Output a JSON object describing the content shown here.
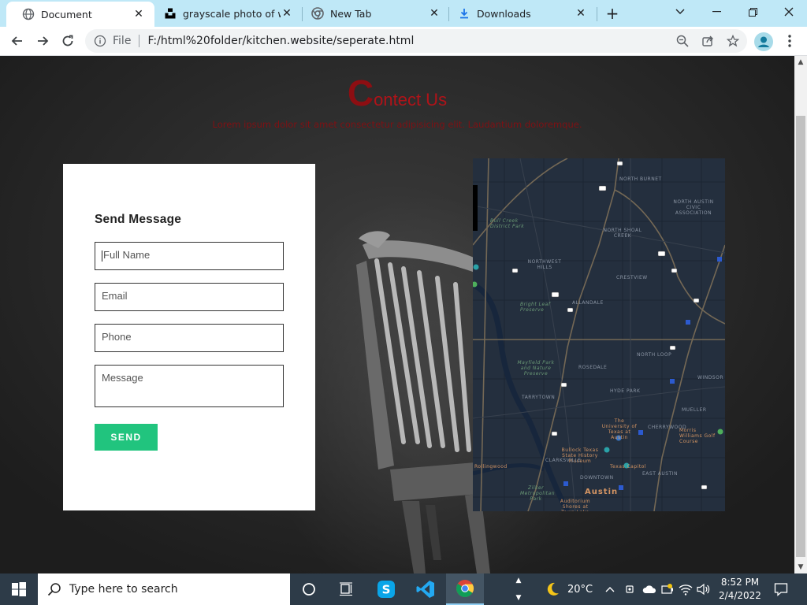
{
  "browser": {
    "tabs": [
      {
        "title": "Document",
        "icon": "globe-icon",
        "active": true
      },
      {
        "title": "grayscale photo of woo",
        "icon": "unsplash-icon",
        "active": false
      },
      {
        "title": "New Tab",
        "icon": "chrome-icon",
        "active": false
      },
      {
        "title": "Downloads",
        "icon": "download-icon",
        "active": false
      }
    ],
    "new_tab_label": "+",
    "address": {
      "scheme_label": "File",
      "url": "F:/html%20folder/kitchen.website/seperate.html"
    }
  },
  "page": {
    "heading_initial": "C",
    "heading_rest": "ontect Us",
    "subtitle": "Lorem ipsum dolor sit amet consectetur adipisicing elit. Laudantium doloremque.",
    "form": {
      "title": "Send Message",
      "fields": {
        "name_placeholder": "Full Name",
        "email_placeholder": "Email",
        "phone_placeholder": "Phone",
        "message_placeholder": "Message"
      },
      "send_label": "SEND"
    },
    "map": {
      "labels": {
        "north_burnet": "NORTH BURNET",
        "north_austin_civic": "NORTH AUSTIN CIVIC ASSOCIATION",
        "north_shoal_creek": "NORTH SHOAL CREEK",
        "bull_creek": "Bull Creek District Park",
        "northwest_hills": "NORTHWEST HILLS",
        "crestview": "CRESTVIEW",
        "bright_leaf": "Bright Leaf Preserve",
        "allandale": "ALLANDALE",
        "north_loop": "NORTH LOOP",
        "mayfield": "Mayfield Park and Nature Preserve",
        "rosedale": "ROSEDALE",
        "windsor": "WINDSOR",
        "tarrytown": "TARRYTOWN",
        "hyde_park": "HYDE PARK",
        "mueller": "MUELLER",
        "ut_austin": "The University of Texas at Austin",
        "cherrywood": "CHERRYWOOD",
        "morris_williams": "Morris Williams Golf Course",
        "bullock": "Bullock Texas State History Museum",
        "clarksville": "CLARKSVILLE",
        "rollingwood": "Rollingwood",
        "texas_capitol": "Texas Capitol",
        "zilker": "Zilker Metropolitan Park",
        "downtown": "DOWNTOWN",
        "east_austin": "EAST AUSTIN",
        "austin": "Austin",
        "auditorium_shores": "Auditorium Shores at Town Lake"
      }
    }
  },
  "taskbar": {
    "search_placeholder": "Type here to search",
    "weather": "20°C",
    "time": "8:52 PM",
    "date": "2/4/2022"
  },
  "colors": {
    "tab_strip": "#bfe8f7",
    "heading_red": "#b01319",
    "send_green": "#21c47e",
    "map_bg": "#242f3e",
    "taskbar": "#2d3b48"
  }
}
